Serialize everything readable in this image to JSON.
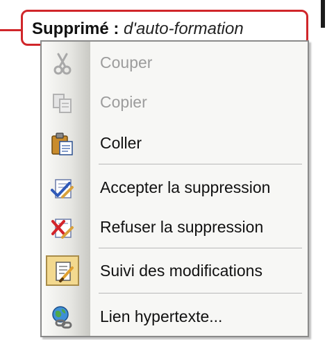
{
  "balloon": {
    "prefix": "Supprimé :",
    "text": "d'auto-formation"
  },
  "menu": {
    "items": [
      {
        "label": "Couper",
        "icon": "scissors-icon",
        "enabled": false
      },
      {
        "label": "Copier",
        "icon": "copy-icon",
        "enabled": false
      },
      {
        "label": "Coller",
        "icon": "paste-icon",
        "enabled": true
      },
      {
        "label": "Accepter la suppression",
        "icon": "accept-change-icon",
        "enabled": true
      },
      {
        "label": "Refuser la suppression",
        "icon": "reject-change-icon",
        "enabled": true
      },
      {
        "label": "Suivi des modifications",
        "icon": "track-changes-icon",
        "enabled": true,
        "checked": true
      },
      {
        "label": "Lien hypertexte...",
        "icon": "hyperlink-icon",
        "enabled": true
      }
    ]
  },
  "colors": {
    "balloon_border": "#d0262a",
    "checked_highlight": "#f3d98f"
  }
}
